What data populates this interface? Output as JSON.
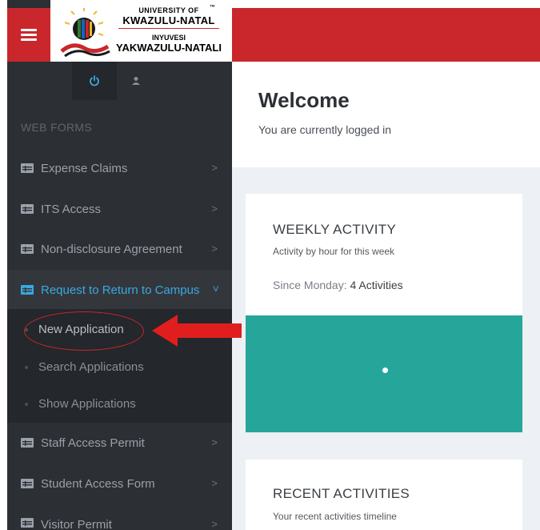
{
  "colors": {
    "brand_red": "#c9272b",
    "sidebar_bg": "#2c2f34",
    "active_blue": "#3aa8e0",
    "teal": "#26a69a"
  },
  "logo": {
    "line1": "UNIVERSITY OF",
    "line2": "KWAZULU-NATAL",
    "line3": "INYUVESI",
    "line4": "YAKWAZULU-NATALI",
    "tm": "™"
  },
  "icons": {
    "menu": "hamburger-icon",
    "power": "power-icon",
    "user": "user-icon",
    "form": "form-icon",
    "chevron": "chevron-right-icon"
  },
  "sidebar": {
    "section_label": "WEB FORMS",
    "items": [
      {
        "label": "Expense Claims",
        "chevron": ">"
      },
      {
        "label": "ITS Access",
        "chevron": ">"
      },
      {
        "label": "Non-disclosure Agreement",
        "chevron": ">"
      },
      {
        "label": "Request to Return to Campus",
        "chevron": ">"
      },
      {
        "label": "Staff Access Permit",
        "chevron": ">"
      },
      {
        "label": "Student Access Form",
        "chevron": ">"
      },
      {
        "label": "Visitor Permit",
        "chevron": ">"
      }
    ],
    "submenu": [
      {
        "label": "New Application"
      },
      {
        "label": "Search Applications"
      },
      {
        "label": "Show Applications"
      }
    ]
  },
  "main": {
    "welcome_title": "Welcome",
    "welcome_subtitle": "You are currently logged in",
    "weekly": {
      "title": "WEEKLY ACTIVITY",
      "subtitle": "Activity by hour for this week",
      "since_label": "Since Monday:",
      "since_value": "4 Activities"
    },
    "recent": {
      "title": "RECENT ACTIVITIES",
      "subtitle": "Your recent activities timeline"
    }
  }
}
